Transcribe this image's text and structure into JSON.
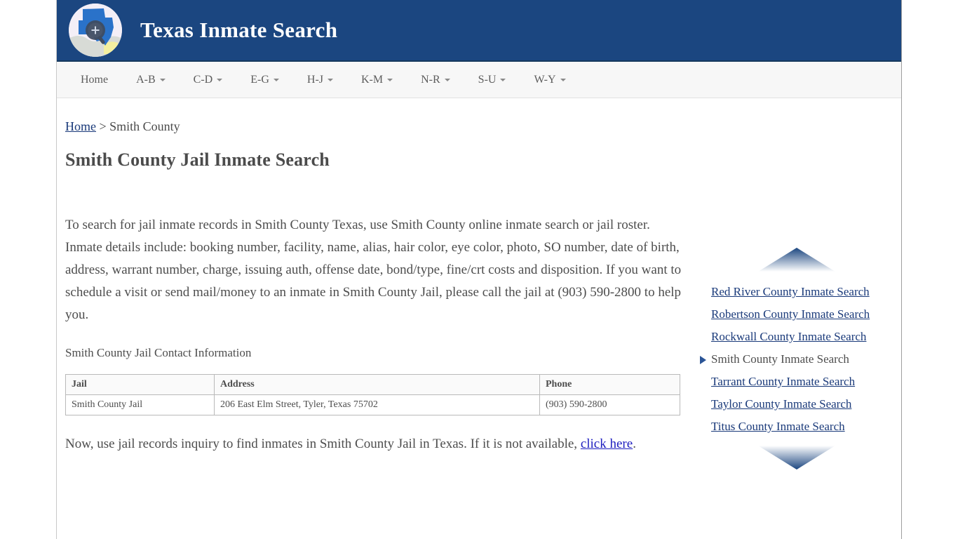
{
  "header": {
    "title": "Texas Inmate Search",
    "logo_icon": "texas-map-magnifier-icon",
    "background_color": "#1b4680"
  },
  "navbar": {
    "items": [
      {
        "label": "Home",
        "has_caret": false
      },
      {
        "label": "A-B",
        "has_caret": true
      },
      {
        "label": "C-D",
        "has_caret": true
      },
      {
        "label": "E-G",
        "has_caret": true
      },
      {
        "label": "H-J",
        "has_caret": true
      },
      {
        "label": "K-M",
        "has_caret": true
      },
      {
        "label": "N-R",
        "has_caret": true
      },
      {
        "label": "S-U",
        "has_caret": true
      },
      {
        "label": "W-Y",
        "has_caret": true
      }
    ]
  },
  "breadcrumb": {
    "home_label": "Home",
    "separator": " > ",
    "current": "Smith County"
  },
  "main": {
    "page_title": "Smith County Jail Inmate Search",
    "paragraph_1": "To search for jail inmate records in Smith County Texas, use Smith County online inmate search or jail roster. Inmate details include: booking number, facility, name, alias, hair color, eye color, photo, SO number, date of birth, address, warrant number, charge, issuing auth, offense date, bond/type, fine/crt costs and disposition. If you want to schedule a visit or send mail/money to an inmate in Smith County Jail, please call the jail at (903) 590-2800 to help you.",
    "contact_heading": "Smith County Jail Contact Information",
    "table": {
      "headers": [
        "Jail",
        "Address",
        "Phone"
      ],
      "rows": [
        [
          "Smith County Jail",
          "206 East Elm Street, Tyler, Texas 75702",
          "(903) 590-2800"
        ]
      ]
    },
    "closing_prefix": "Now, use jail records inquiry to find inmates in Smith County Jail in Texas. If it is not available, ",
    "closing_link": "click here",
    "closing_suffix": "."
  },
  "sidebar": {
    "top_arrow_icon": "triangle-up-icon",
    "bottom_arrow_icon": "triangle-down-icon",
    "marker_icon": "triangle-right-marker-icon",
    "accent_color": "#1a3a7a",
    "items": [
      {
        "label": "Red River County Inmate Search",
        "active": false
      },
      {
        "label": "Robertson County Inmate Search",
        "active": false
      },
      {
        "label": "Rockwall County Inmate Search",
        "active": false
      },
      {
        "label": "Smith County Inmate Search",
        "active": true
      },
      {
        "label": "Tarrant County Inmate Search",
        "active": false
      },
      {
        "label": "Taylor County Inmate Search",
        "active": false
      },
      {
        "label": "Titus County Inmate Search",
        "active": false
      }
    ]
  }
}
